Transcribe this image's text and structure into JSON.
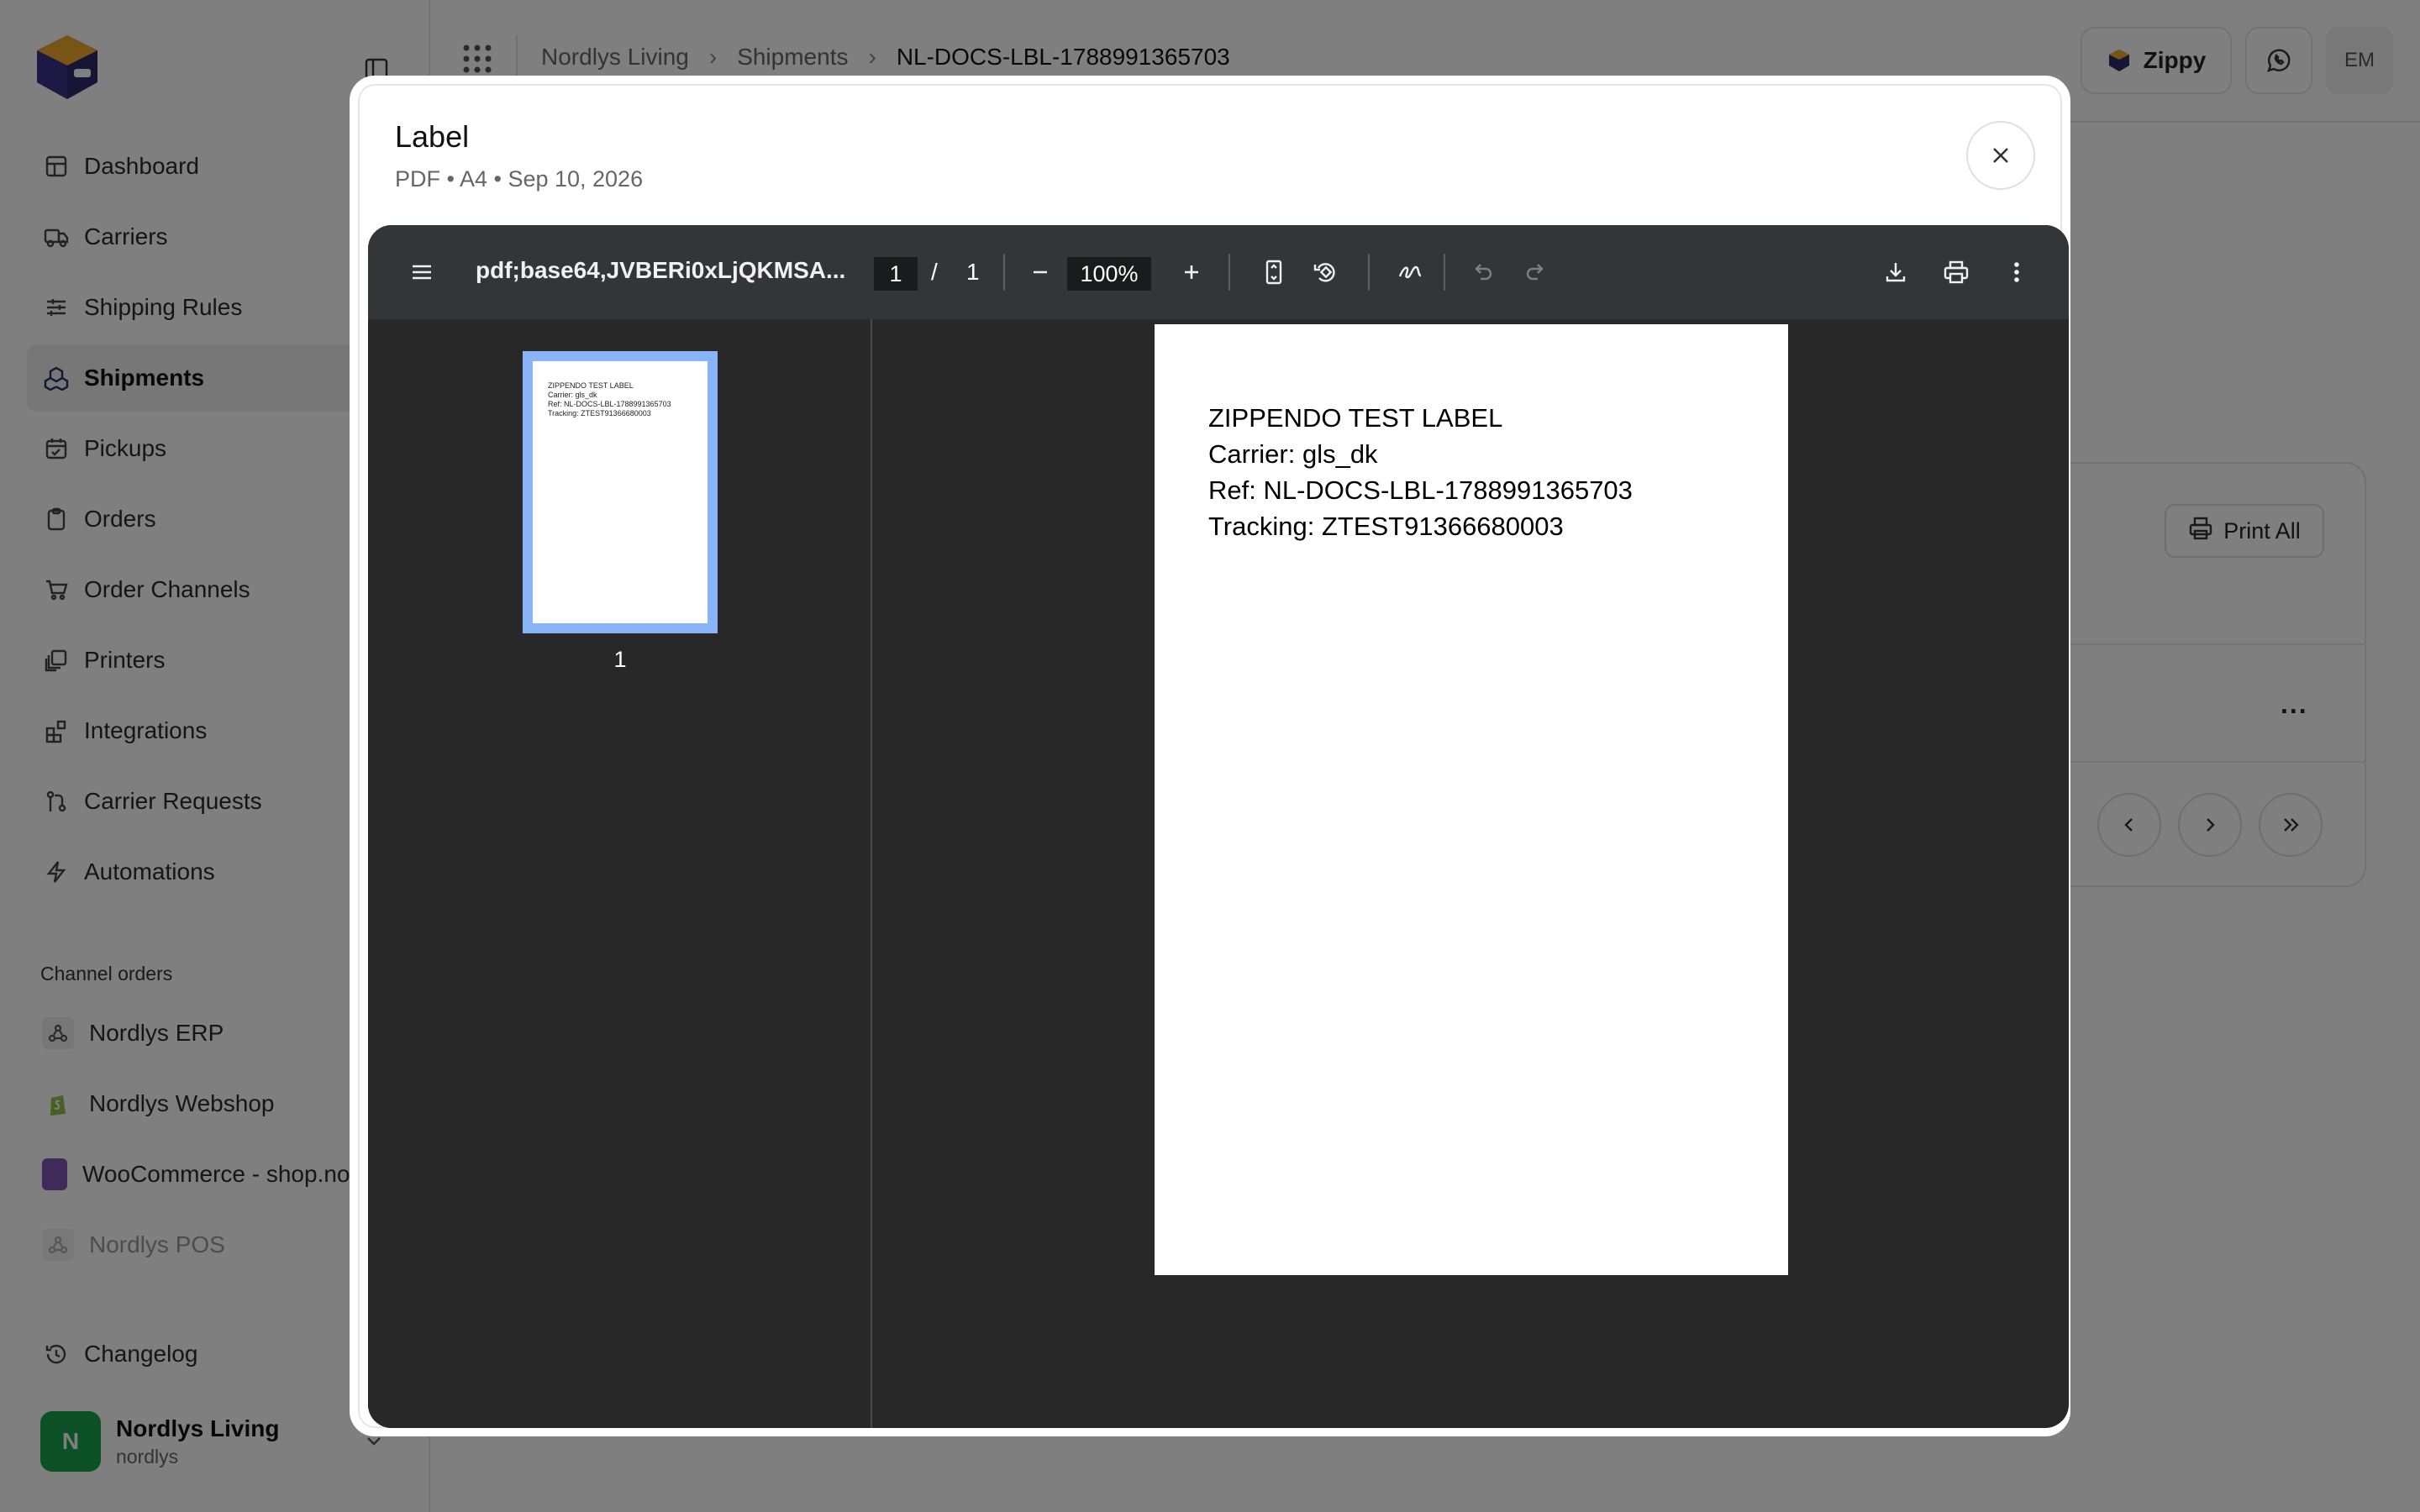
{
  "sidebar": {
    "nav": [
      {
        "label": "Dashboard",
        "icon": "dashboard-icon"
      },
      {
        "label": "Carriers",
        "icon": "truck-icon"
      },
      {
        "label": "Shipping Rules",
        "icon": "sliders-icon"
      },
      {
        "label": "Shipments",
        "icon": "boxes-icon",
        "active": true
      },
      {
        "label": "Pickups",
        "icon": "calendar-check-icon"
      },
      {
        "label": "Orders",
        "icon": "clipboard-icon"
      },
      {
        "label": "Order Channels",
        "icon": "cart-icon"
      },
      {
        "label": "Printers",
        "icon": "printer-stack-icon"
      },
      {
        "label": "Integrations",
        "icon": "blocks-icon"
      },
      {
        "label": "Carrier Requests",
        "icon": "git-pull-icon"
      },
      {
        "label": "Automations",
        "icon": "zap-icon"
      }
    ],
    "channel_section_label": "Channel orders",
    "channels": [
      {
        "label": "Nordlys ERP",
        "icon": "webhook-icon"
      },
      {
        "label": "Nordlys Webshop",
        "icon": "shopify-icon"
      },
      {
        "label": "WooCommerce - shop.no",
        "icon": "woocommerce-icon"
      },
      {
        "label": "Nordlys POS",
        "icon": "webhook-icon",
        "dimmed": true
      }
    ],
    "changelog_label": "Changelog",
    "account": {
      "initial": "N",
      "name": "Nordlys Living",
      "handle": "nordlys"
    }
  },
  "topbar": {
    "breadcrumbs": [
      "Nordlys Living",
      "Shipments",
      "NL-DOCS-LBL-1788991365703"
    ],
    "assistant_label": "Zippy",
    "user_initials": "EM"
  },
  "background": {
    "print_all_label": "Print All",
    "row_more_label": "..."
  },
  "modal": {
    "title": "Label",
    "subtitle": "PDF • A4 • Sep 10, 2026"
  },
  "viewer": {
    "file_title": "pdf;base64,JVBERi0xLjQKMSA...",
    "current_page": "1",
    "page_separator": "/",
    "total_pages": "1",
    "zoom": "100%",
    "thumbnail_number": "1",
    "document_lines": [
      "ZIPPENDO TEST LABEL",
      "Carrier: gls_dk",
      "Ref: NL-DOCS-LBL-1788991365703",
      "Tracking: ZTEST91366680003"
    ]
  },
  "colors": {
    "thumbnail_selection": "#8ab4f8",
    "viewer_toolbar": "#323639",
    "viewer_background": "#282828",
    "active_avatar": "#16a34a"
  }
}
